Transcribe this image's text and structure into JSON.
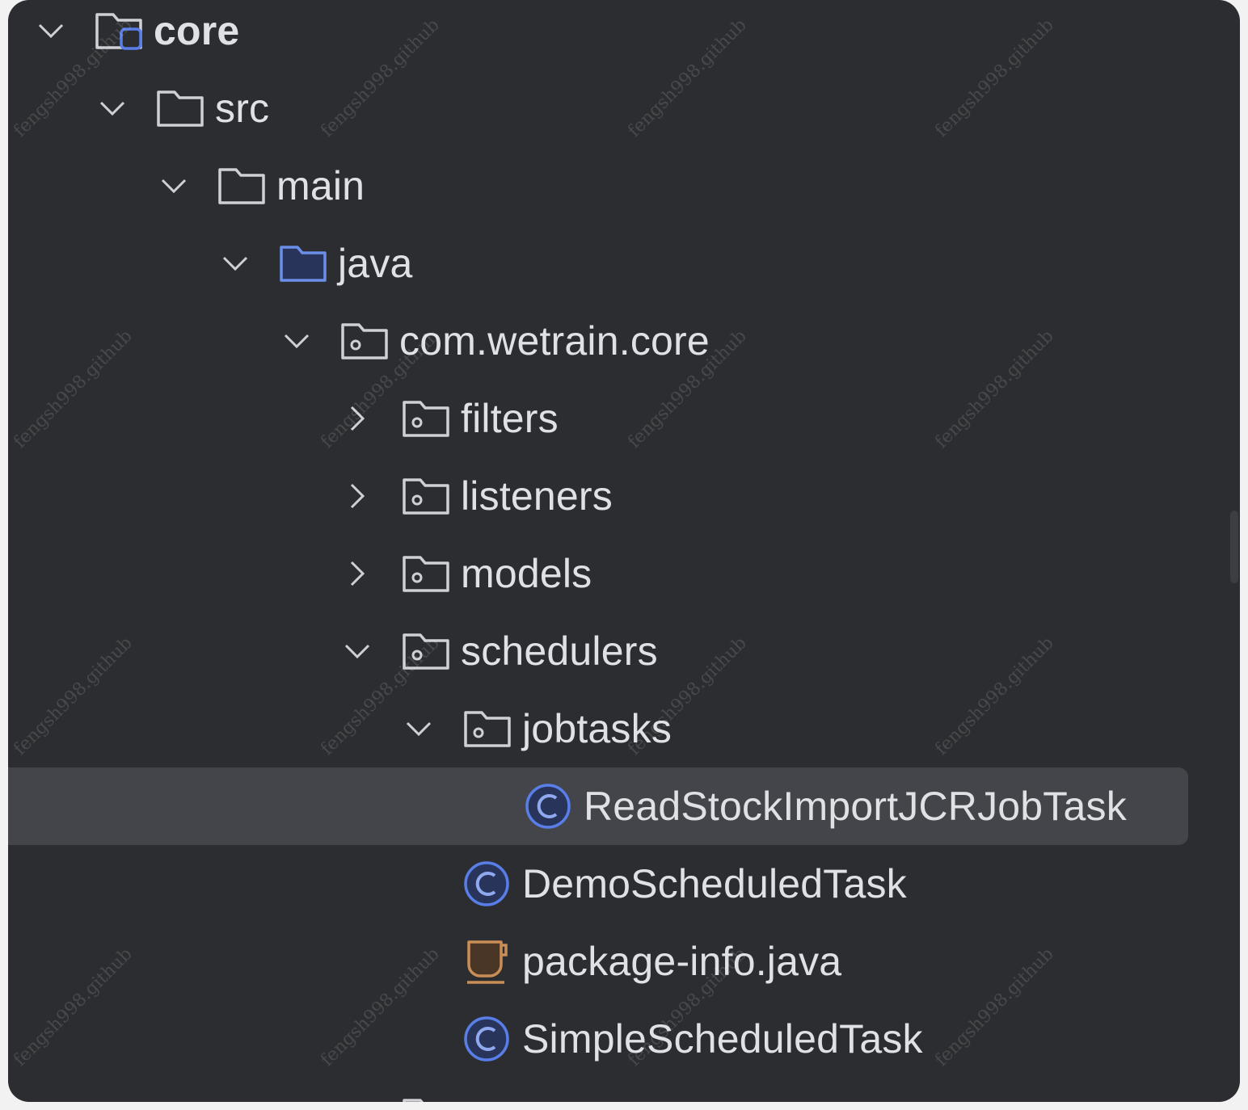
{
  "tree": [
    {
      "label": "core",
      "icon": "module-folder-icon",
      "expanded": true,
      "bold": true
    },
    {
      "label": "src",
      "icon": "folder-icon",
      "expanded": true
    },
    {
      "label": "main",
      "icon": "folder-icon",
      "expanded": true
    },
    {
      "label": "java",
      "icon": "source-folder-icon",
      "expanded": true
    },
    {
      "label": "com.wetrain.core",
      "icon": "package-icon",
      "expanded": true
    },
    {
      "label": "filters",
      "icon": "package-icon",
      "expanded": false
    },
    {
      "label": "listeners",
      "icon": "package-icon",
      "expanded": false
    },
    {
      "label": "models",
      "icon": "package-icon",
      "expanded": false
    },
    {
      "label": "schedulers",
      "icon": "package-icon",
      "expanded": true
    },
    {
      "label": "jobtasks",
      "icon": "package-icon",
      "expanded": true
    },
    {
      "label": "ReadStockImportJCRJobTask",
      "icon": "class-icon",
      "selected": true
    },
    {
      "label": "DemoScheduledTask",
      "icon": "class-icon"
    },
    {
      "label": "package-info.java",
      "icon": "java-file-icon"
    },
    {
      "label": "SimpleScheduledTask",
      "icon": "class-icon"
    }
  ],
  "watermark": "fengsh998.github",
  "colors": {
    "background": "#2b2d30",
    "selection": "#43454a",
    "text": "#dfe1e5",
    "class_icon": "#5a7ee8",
    "source_folder": "#6b8fe8",
    "java_file": "#c98d56"
  }
}
